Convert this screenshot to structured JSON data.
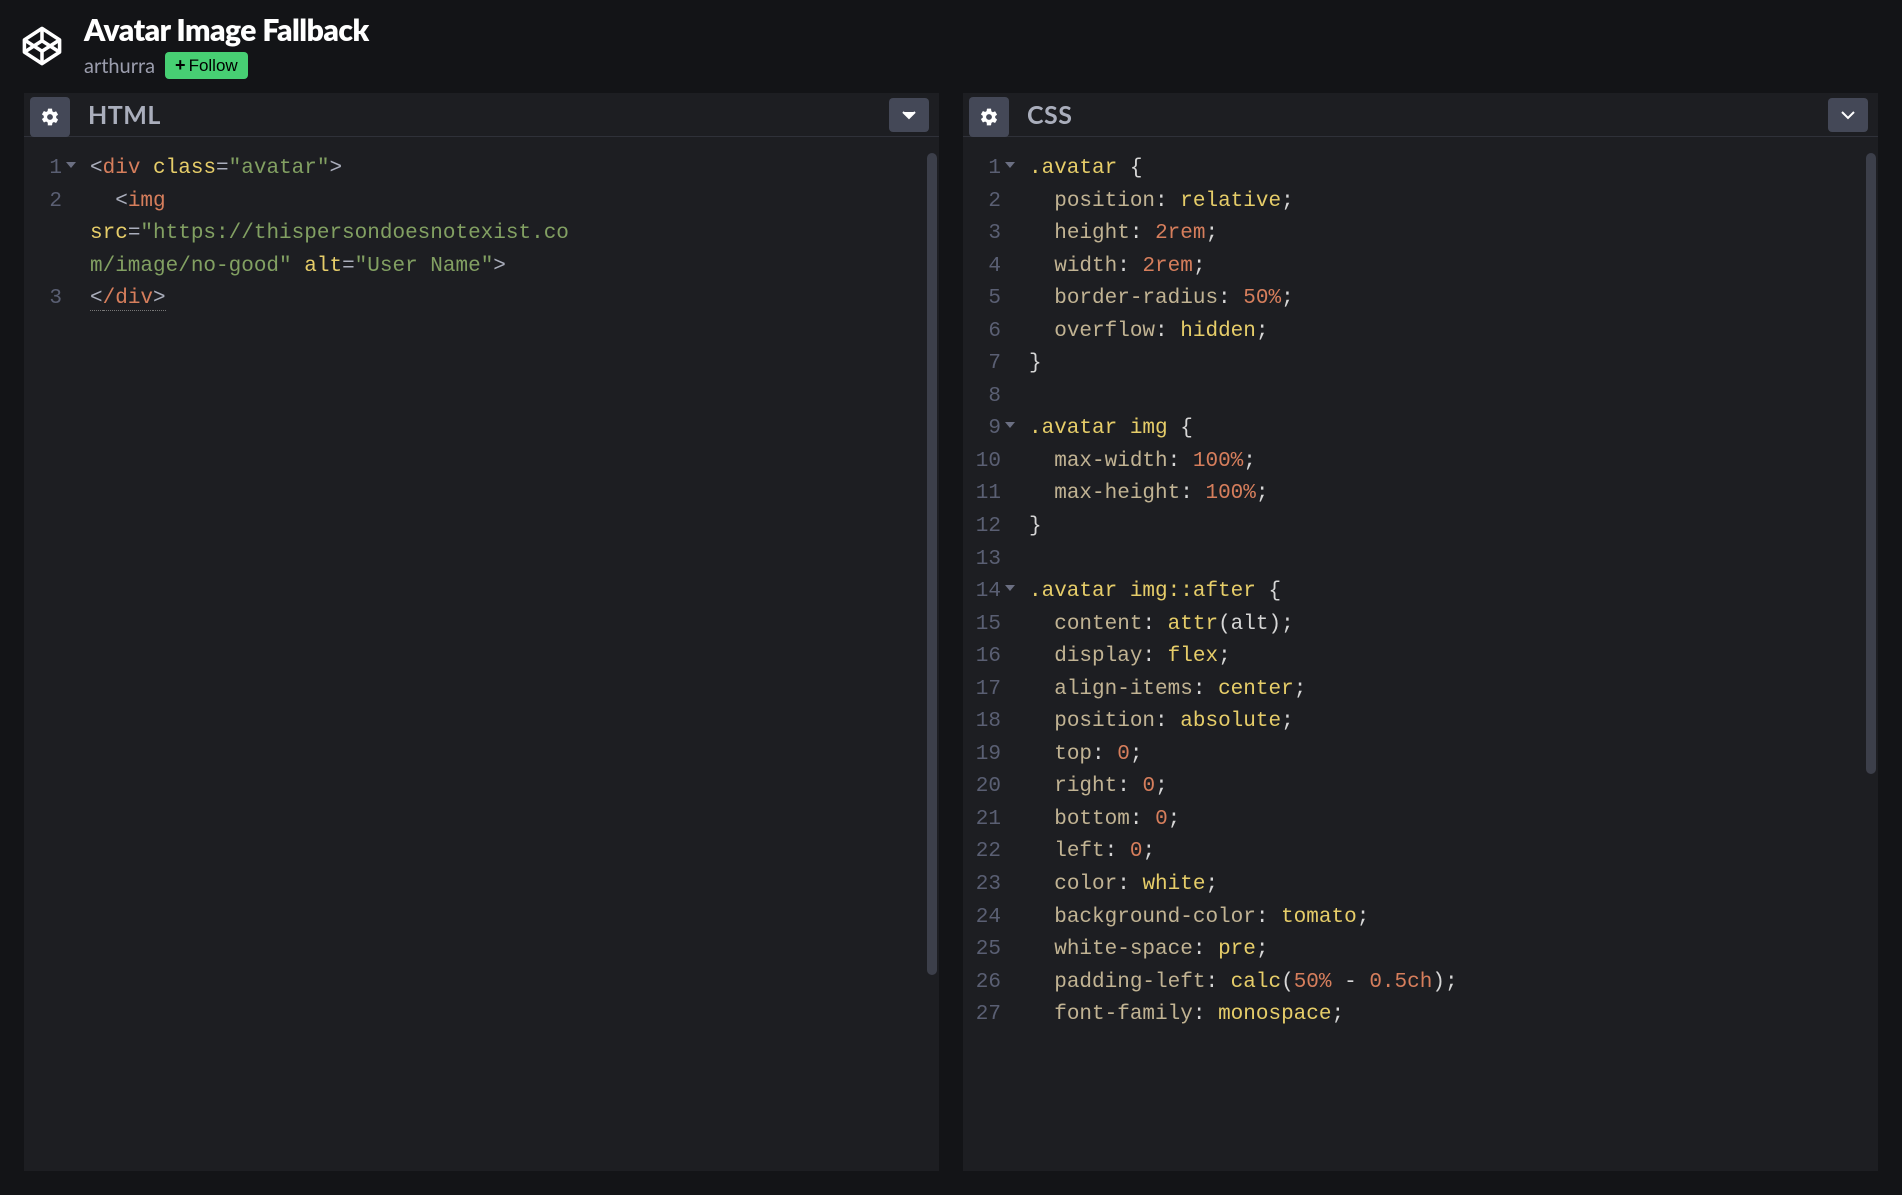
{
  "header": {
    "title": "Avatar Image Fallback",
    "author": "arthurra",
    "follow_label": "Follow"
  },
  "panels": {
    "html": {
      "title": "HTML"
    },
    "css": {
      "title": "CSS"
    }
  },
  "html_code": {
    "lines": [
      {
        "n": "1",
        "fold": true,
        "segs": [
          {
            "t": "<",
            "c": "t-punc"
          },
          {
            "t": "div",
            "c": "t-tag"
          },
          {
            "t": " ",
            "c": ""
          },
          {
            "t": "class",
            "c": "t-attr"
          },
          {
            "t": "=",
            "c": "t-punc"
          },
          {
            "t": "\"avatar\"",
            "c": "t-str"
          },
          {
            "t": ">",
            "c": "t-punc"
          }
        ]
      },
      {
        "n": "2",
        "segs": [
          {
            "t": "  ",
            "c": ""
          },
          {
            "t": "<",
            "c": "t-punc"
          },
          {
            "t": "img",
            "c": "t-tag"
          },
          {
            "t": " ",
            "c": ""
          }
        ]
      },
      {
        "n": "",
        "segs": [
          {
            "t": "src",
            "c": "t-attr"
          },
          {
            "t": "=",
            "c": "t-punc"
          },
          {
            "t": "\"https://thispersondoesnotexist.co",
            "c": "t-str"
          }
        ]
      },
      {
        "n": "",
        "segs": [
          {
            "t": "m/image/no-good\"",
            "c": "t-str"
          },
          {
            "t": " ",
            "c": ""
          },
          {
            "t": "alt",
            "c": "t-attr"
          },
          {
            "t": "=",
            "c": "t-punc"
          },
          {
            "t": "\"User Name\"",
            "c": "t-str"
          },
          {
            "t": ">",
            "c": "t-punc"
          }
        ]
      },
      {
        "n": "3",
        "segs": [
          {
            "t": "<",
            "c": "t-punc u-dotted"
          },
          {
            "t": "/div",
            "c": "t-tag u-dotted"
          },
          {
            "t": ">",
            "c": "t-punc u-dotted"
          }
        ]
      }
    ]
  },
  "css_code": {
    "lines": [
      {
        "n": "1",
        "fold": true,
        "segs": [
          {
            "t": ".avatar",
            "c": "t-sel"
          },
          {
            "t": " {",
            "c": "t-pl"
          }
        ]
      },
      {
        "n": "2",
        "segs": [
          {
            "t": "  ",
            "c": ""
          },
          {
            "t": "position",
            "c": "t-prop"
          },
          {
            "t": ": ",
            "c": "t-pl"
          },
          {
            "t": "relative",
            "c": "t-val"
          },
          {
            "t": ";",
            "c": "t-pl"
          }
        ]
      },
      {
        "n": "3",
        "segs": [
          {
            "t": "  ",
            "c": ""
          },
          {
            "t": "height",
            "c": "t-prop"
          },
          {
            "t": ": ",
            "c": "t-pl"
          },
          {
            "t": "2rem",
            "c": "t-num"
          },
          {
            "t": ";",
            "c": "t-pl"
          }
        ]
      },
      {
        "n": "4",
        "segs": [
          {
            "t": "  ",
            "c": ""
          },
          {
            "t": "width",
            "c": "t-prop"
          },
          {
            "t": ": ",
            "c": "t-pl"
          },
          {
            "t": "2rem",
            "c": "t-num"
          },
          {
            "t": ";",
            "c": "t-pl"
          }
        ]
      },
      {
        "n": "5",
        "segs": [
          {
            "t": "  ",
            "c": ""
          },
          {
            "t": "border-radius",
            "c": "t-prop"
          },
          {
            "t": ": ",
            "c": "t-pl"
          },
          {
            "t": "50%",
            "c": "t-num"
          },
          {
            "t": ";",
            "c": "t-pl"
          }
        ]
      },
      {
        "n": "6",
        "segs": [
          {
            "t": "  ",
            "c": ""
          },
          {
            "t": "overflow",
            "c": "t-prop"
          },
          {
            "t": ": ",
            "c": "t-pl"
          },
          {
            "t": "hidden",
            "c": "t-val"
          },
          {
            "t": ";",
            "c": "t-pl"
          }
        ]
      },
      {
        "n": "7",
        "segs": [
          {
            "t": "}",
            "c": "t-pl"
          }
        ]
      },
      {
        "n": "8",
        "segs": [
          {
            "t": " ",
            "c": ""
          }
        ]
      },
      {
        "n": "9",
        "fold": true,
        "segs": [
          {
            "t": ".avatar",
            "c": "t-sel"
          },
          {
            "t": " ",
            "c": ""
          },
          {
            "t": "img",
            "c": "t-sel"
          },
          {
            "t": " {",
            "c": "t-pl"
          }
        ]
      },
      {
        "n": "10",
        "segs": [
          {
            "t": "  ",
            "c": ""
          },
          {
            "t": "max-width",
            "c": "t-prop"
          },
          {
            "t": ": ",
            "c": "t-pl"
          },
          {
            "t": "100%",
            "c": "t-num"
          },
          {
            "t": ";",
            "c": "t-pl"
          }
        ]
      },
      {
        "n": "11",
        "segs": [
          {
            "t": "  ",
            "c": ""
          },
          {
            "t": "max-height",
            "c": "t-prop"
          },
          {
            "t": ": ",
            "c": "t-pl"
          },
          {
            "t": "100%",
            "c": "t-num"
          },
          {
            "t": ";",
            "c": "t-pl"
          }
        ]
      },
      {
        "n": "12",
        "segs": [
          {
            "t": "}",
            "c": "t-pl"
          }
        ]
      },
      {
        "n": "13",
        "segs": [
          {
            "t": " ",
            "c": ""
          }
        ]
      },
      {
        "n": "14",
        "fold": true,
        "segs": [
          {
            "t": ".avatar",
            "c": "t-sel"
          },
          {
            "t": " ",
            "c": ""
          },
          {
            "t": "img",
            "c": "t-sel"
          },
          {
            "t": "::after",
            "c": "t-sel"
          },
          {
            "t": " {",
            "c": "t-pl"
          }
        ]
      },
      {
        "n": "15",
        "segs": [
          {
            "t": "  ",
            "c": ""
          },
          {
            "t": "content",
            "c": "t-prop"
          },
          {
            "t": ": ",
            "c": "t-pl"
          },
          {
            "t": "attr",
            "c": "t-val"
          },
          {
            "t": "(alt)",
            "c": "t-pl"
          },
          {
            "t": ";",
            "c": "t-pl"
          }
        ]
      },
      {
        "n": "16",
        "segs": [
          {
            "t": "  ",
            "c": ""
          },
          {
            "t": "display",
            "c": "t-prop"
          },
          {
            "t": ": ",
            "c": "t-pl"
          },
          {
            "t": "flex",
            "c": "t-val"
          },
          {
            "t": ";",
            "c": "t-pl"
          }
        ]
      },
      {
        "n": "17",
        "segs": [
          {
            "t": "  ",
            "c": ""
          },
          {
            "t": "align-items",
            "c": "t-prop"
          },
          {
            "t": ": ",
            "c": "t-pl"
          },
          {
            "t": "center",
            "c": "t-val"
          },
          {
            "t": ";",
            "c": "t-pl"
          }
        ]
      },
      {
        "n": "18",
        "segs": [
          {
            "t": "  ",
            "c": ""
          },
          {
            "t": "position",
            "c": "t-prop"
          },
          {
            "t": ": ",
            "c": "t-pl"
          },
          {
            "t": "absolute",
            "c": "t-val"
          },
          {
            "t": ";",
            "c": "t-pl"
          }
        ]
      },
      {
        "n": "19",
        "segs": [
          {
            "t": "  ",
            "c": ""
          },
          {
            "t": "top",
            "c": "t-prop"
          },
          {
            "t": ": ",
            "c": "t-pl"
          },
          {
            "t": "0",
            "c": "t-num"
          },
          {
            "t": ";",
            "c": "t-pl"
          }
        ]
      },
      {
        "n": "20",
        "segs": [
          {
            "t": "  ",
            "c": ""
          },
          {
            "t": "right",
            "c": "t-prop"
          },
          {
            "t": ": ",
            "c": "t-pl"
          },
          {
            "t": "0",
            "c": "t-num"
          },
          {
            "t": ";",
            "c": "t-pl"
          }
        ]
      },
      {
        "n": "21",
        "segs": [
          {
            "t": "  ",
            "c": ""
          },
          {
            "t": "bottom",
            "c": "t-prop"
          },
          {
            "t": ": ",
            "c": "t-pl"
          },
          {
            "t": "0",
            "c": "t-num"
          },
          {
            "t": ";",
            "c": "t-pl"
          }
        ]
      },
      {
        "n": "22",
        "segs": [
          {
            "t": "  ",
            "c": ""
          },
          {
            "t": "left",
            "c": "t-prop"
          },
          {
            "t": ": ",
            "c": "t-pl"
          },
          {
            "t": "0",
            "c": "t-num"
          },
          {
            "t": ";",
            "c": "t-pl"
          }
        ]
      },
      {
        "n": "23",
        "segs": [
          {
            "t": "  ",
            "c": ""
          },
          {
            "t": "color",
            "c": "t-prop"
          },
          {
            "t": ": ",
            "c": "t-pl"
          },
          {
            "t": "white",
            "c": "t-val"
          },
          {
            "t": ";",
            "c": "t-pl"
          }
        ]
      },
      {
        "n": "24",
        "segs": [
          {
            "t": "  ",
            "c": ""
          },
          {
            "t": "background-color",
            "c": "t-prop"
          },
          {
            "t": ": ",
            "c": "t-pl"
          },
          {
            "t": "tomato",
            "c": "t-val"
          },
          {
            "t": ";",
            "c": "t-pl"
          }
        ]
      },
      {
        "n": "25",
        "segs": [
          {
            "t": "  ",
            "c": ""
          },
          {
            "t": "white-space",
            "c": "t-prop"
          },
          {
            "t": ": ",
            "c": "t-pl"
          },
          {
            "t": "pre",
            "c": "t-val"
          },
          {
            "t": ";",
            "c": "t-pl"
          }
        ]
      },
      {
        "n": "26",
        "segs": [
          {
            "t": "  ",
            "c": ""
          },
          {
            "t": "padding-left",
            "c": "t-prop"
          },
          {
            "t": ": ",
            "c": "t-pl"
          },
          {
            "t": "calc",
            "c": "t-val"
          },
          {
            "t": "(",
            "c": "t-pl"
          },
          {
            "t": "50%",
            "c": "t-num"
          },
          {
            "t": " - ",
            "c": "t-pl"
          },
          {
            "t": "0.5ch",
            "c": "t-num"
          },
          {
            "t": ")",
            "c": "t-pl"
          },
          {
            "t": ";",
            "c": "t-pl"
          }
        ]
      },
      {
        "n": "27",
        "segs": [
          {
            "t": "  ",
            "c": ""
          },
          {
            "t": "font-family",
            "c": "t-prop"
          },
          {
            "t": ": ",
            "c": "t-pl"
          },
          {
            "t": "monospace",
            "c": "t-val"
          },
          {
            "t": ";",
            "c": "t-pl"
          }
        ]
      }
    ]
  }
}
